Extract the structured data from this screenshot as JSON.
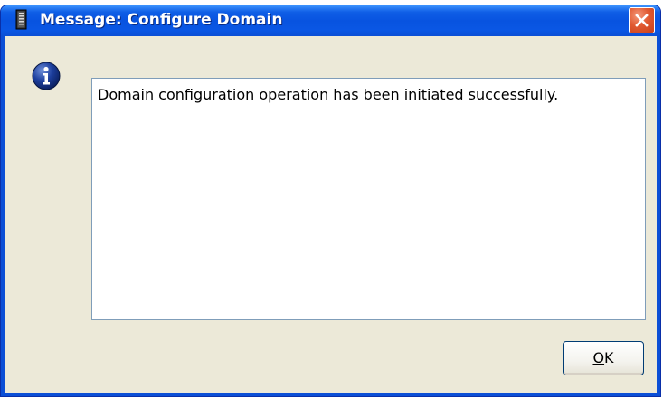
{
  "window": {
    "title": "Message: Configure Domain",
    "title_icon": "server-icon",
    "close_icon": "close-icon"
  },
  "message": {
    "icon": "info-icon",
    "text": "Domain configuration operation has been initiated successfully."
  },
  "buttons": {
    "ok_mnemonic": "O",
    "ok_rest": "K"
  },
  "colors": {
    "titlebar": "#0853e0",
    "client_background": "#ece9d8",
    "close_button": "#e15a32",
    "info_icon": "#0a246a"
  }
}
